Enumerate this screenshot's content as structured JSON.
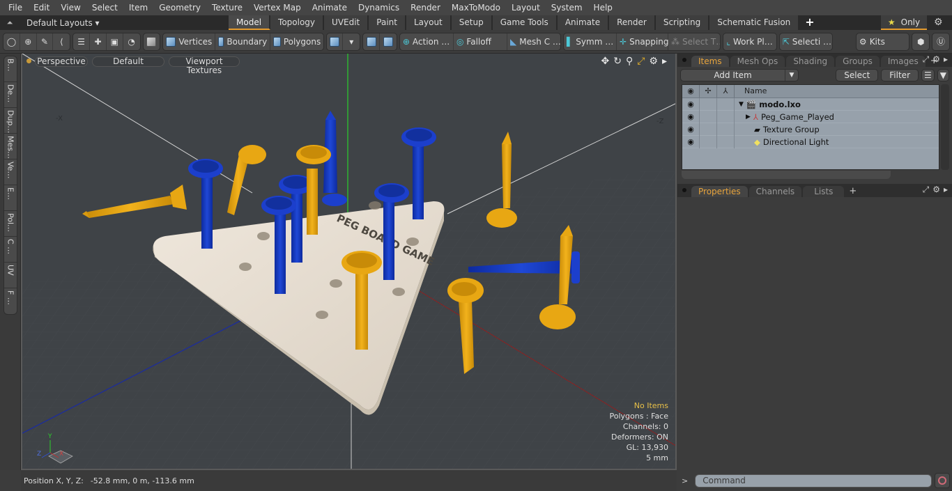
{
  "menu": [
    "File",
    "Edit",
    "View",
    "Select",
    "Item",
    "Geometry",
    "Texture",
    "Vertex Map",
    "Animate",
    "Dynamics",
    "Render",
    "MaxToModo",
    "Layout",
    "System",
    "Help"
  ],
  "layoutbar": {
    "layout_select": "Default Layouts ▾",
    "tabs": [
      "Model",
      "Topology",
      "UVEdit",
      "Paint",
      "Layout",
      "Setup",
      "Game Tools",
      "Animate",
      "Render",
      "Scripting",
      "Schematic Fusion"
    ],
    "active_tab": "Model",
    "add_tab": "+",
    "only_label": "Only"
  },
  "toolbar": {
    "vertices": "Vertices",
    "boundary": "Boundary",
    "polygons": "Polygons",
    "action": "Action …",
    "falloff": "Falloff",
    "mesh": "Mesh C …",
    "symm": "Symm …",
    "snapping": "Snapping",
    "select_t": "Select T…",
    "workpl": "Work Pl…",
    "selecti": "Selecti …",
    "kits": "Kits"
  },
  "left_tabs": [
    "B…",
    "De…",
    "Dup…",
    "Mes…",
    "Ve…",
    "E…",
    "Pol…",
    "C …",
    "UV",
    "F …"
  ],
  "viewport": {
    "view_mode": "Perspective",
    "shading": "Default",
    "texture_mode": "Viewport Textures",
    "axis_labels": {
      "neg_x": "-X",
      "neg_z": "-Z"
    },
    "board_text_title": "PEG BOARD GAME",
    "info": {
      "selection": "No Items",
      "polygons": "Polygons : Face",
      "channels": "Channels: 0",
      "deformers": "Deformers: ON",
      "gl": "GL: 13,930",
      "unit": "5 mm"
    },
    "gizmo": {
      "x": "X",
      "y": "Y",
      "z": "Z"
    },
    "colors": {
      "peg_blue": "#1a3fc4",
      "peg_yellow": "#e8a713",
      "board": "#e6ddd0",
      "background": "#3f4347"
    }
  },
  "status": {
    "label": "Position X, Y, Z:",
    "value": "-52.8 mm, 0 m, -113.6 mm"
  },
  "items_panel": {
    "tabs": [
      "Items",
      "Mesh Ops",
      "Shading",
      "Groups",
      "Images"
    ],
    "active_tab": "Items",
    "add_item": "Add Item",
    "select": "Select",
    "filter": "Filter",
    "column_name": "Name",
    "rows": [
      {
        "name": "modo.lxo",
        "bold": true
      },
      {
        "name": "Peg_Game_Played"
      },
      {
        "name": "Texture Group"
      },
      {
        "name": "Directional Light"
      }
    ]
  },
  "properties_panel": {
    "tabs": [
      "Properties",
      "Channels",
      "Lists"
    ],
    "active_tab": "Properties"
  },
  "command": {
    "prompt": ">",
    "placeholder": "Command"
  }
}
